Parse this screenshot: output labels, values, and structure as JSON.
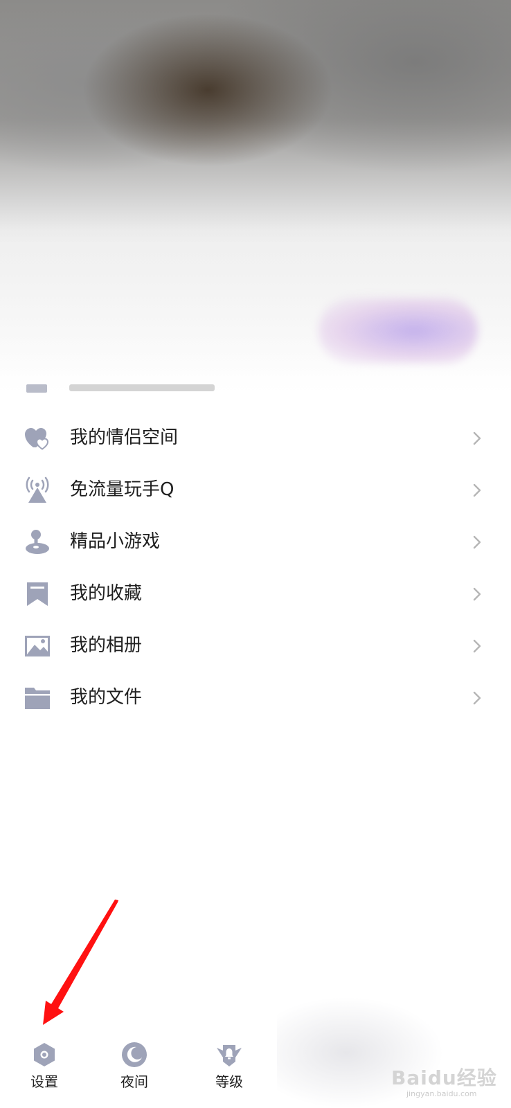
{
  "menu": {
    "items": [
      {
        "label": "我的情侣空间",
        "icon": "couple-heart-icon"
      },
      {
        "label": "免流量玩手Q",
        "icon": "signal-tower-icon"
      },
      {
        "label": "精品小游戏",
        "icon": "game-joystick-icon"
      },
      {
        "label": "我的收藏",
        "icon": "bookmark-icon"
      },
      {
        "label": "我的相册",
        "icon": "photo-album-icon"
      },
      {
        "label": "我的文件",
        "icon": "folder-icon"
      }
    ]
  },
  "bottom_bar": {
    "settings_label": "设置",
    "night_label": "夜间",
    "level_label": "等级"
  },
  "watermark": {
    "main": "Baidu经验",
    "sub": "jingyan.baidu.com"
  },
  "colors": {
    "icon": "#9ea3b8",
    "text": "#1f1f1f",
    "chevron": "#b5b5b5",
    "annotation_arrow": "#ff1111"
  }
}
